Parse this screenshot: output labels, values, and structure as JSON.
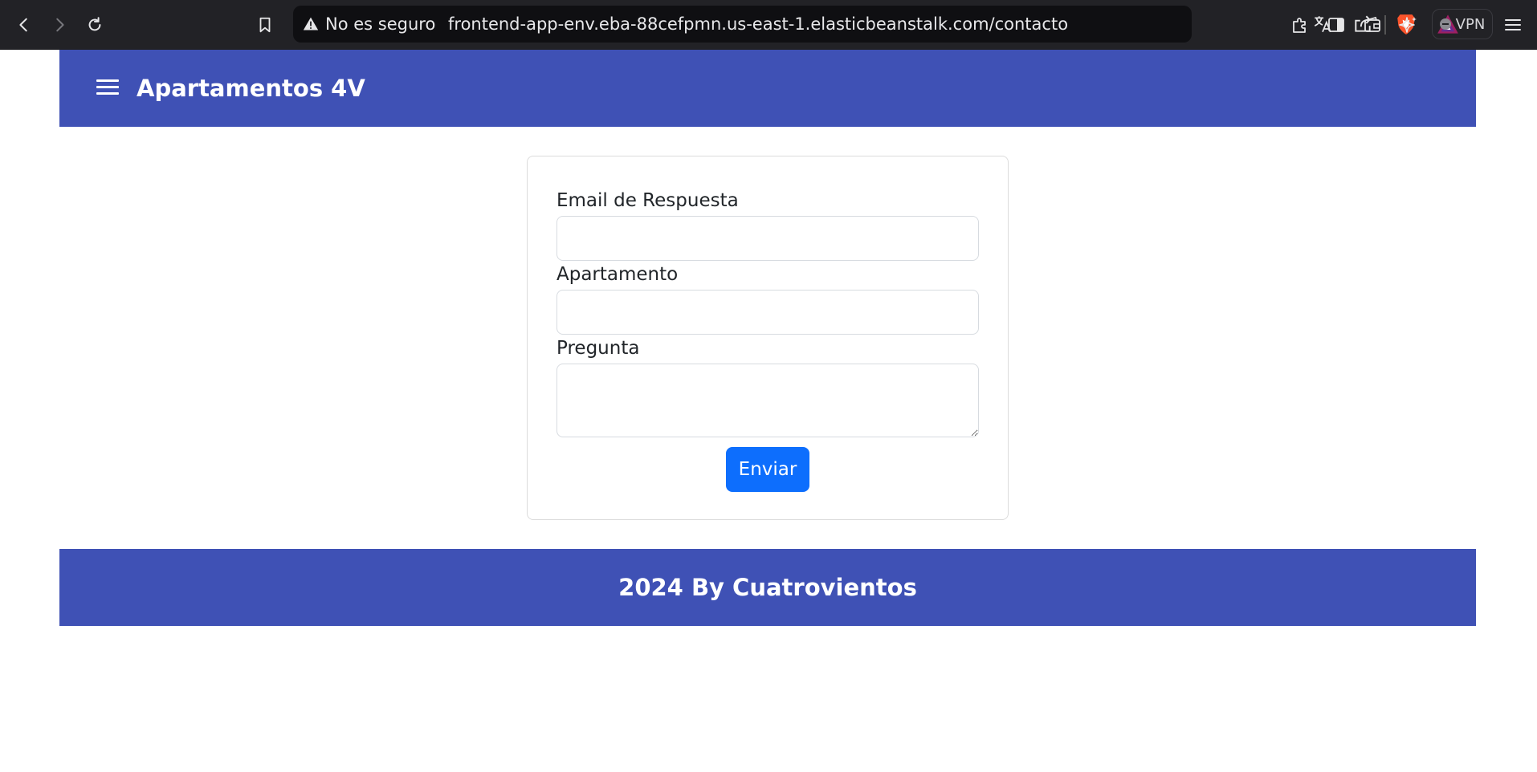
{
  "browser": {
    "security_label": "No es seguro",
    "url": "frontend-app-env.eba-88cefpmn.us-east-1.elasticbeanstalk.com/contacto",
    "vpn_label": "VPN",
    "icons": [
      "back-icon",
      "forward-icon",
      "reload-icon",
      "bookmark-icon",
      "warning-icon",
      "translate-icon",
      "share-icon",
      "brave-shield-icon",
      "brave-rewards-icon",
      "extensions-icon",
      "sidebar-icon",
      "wallet-icon",
      "leo-ai-icon",
      "menu-icon"
    ]
  },
  "header": {
    "title": "Apartamentos 4V",
    "background": "#3f51b5"
  },
  "form": {
    "email_label": "Email de Respuesta",
    "email_value": "",
    "apartment_label": "Apartamento",
    "apartment_value": "",
    "question_label": "Pregunta",
    "question_value": "",
    "submit_label": "Enviar",
    "submit_color": "#0d6efd"
  },
  "footer": {
    "text": "2024 By Cuatrovientos",
    "background": "#3f51b5"
  }
}
